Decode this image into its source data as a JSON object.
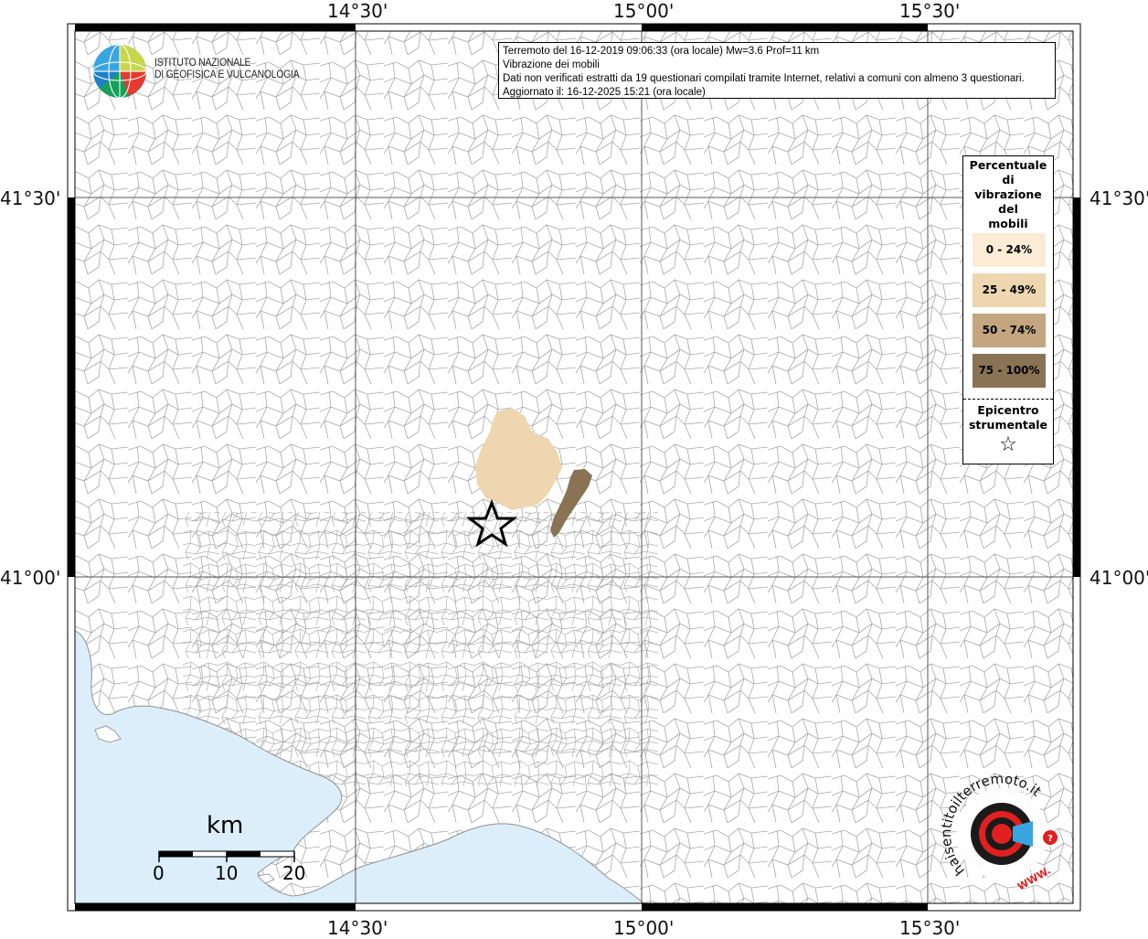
{
  "map": {
    "axes": {
      "lon_ticks": [
        "14°30'",
        "15°00'",
        "15°30'"
      ],
      "lat_ticks": [
        "41°30'",
        "41°00'"
      ]
    },
    "info": {
      "line1": "Terremoto del 16-12-2019 09:06:33 (ora locale) Mw=3.6 Prof=11 km",
      "line2": "Vibrazione dei mobili",
      "line3": "Dati non verificati estratti da 19 questionari compilati tramite Internet, relativi a comuni con almeno 3 questionari.",
      "line4": "Aggiornato il: 16-12-2025 15:21 (ora locale)"
    },
    "institute": {
      "line1": "ISTITUTO NAZIONALE",
      "line2": "DI GEOFISICA E VULCANOLOGIA"
    },
    "legend": {
      "title": "Percentuale\ndi\nvibrazione\ndel\nmobili",
      "classes": [
        {
          "label": "0 - 24%",
          "color": "#FCEBD5"
        },
        {
          "label": "25 - 49%",
          "color": "#EDD6B0"
        },
        {
          "label": "50 - 74%",
          "color": "#C3A57F"
        },
        {
          "label": "75 - 100%",
          "color": "#8A7254"
        }
      ],
      "epicenter_label": "Epicentro\nstrumentale",
      "epicenter_symbol": "☆"
    },
    "scalebar": {
      "unit": "km",
      "ticks": [
        "0",
        "10",
        "20"
      ]
    },
    "colors": {
      "sea": "#DDEEFB",
      "boundaries": "#9A9A9A",
      "grid": "#555555"
    },
    "badge": {
      "text": "haisentitoilterremoto.it",
      "url_text": "WWW."
    }
  }
}
